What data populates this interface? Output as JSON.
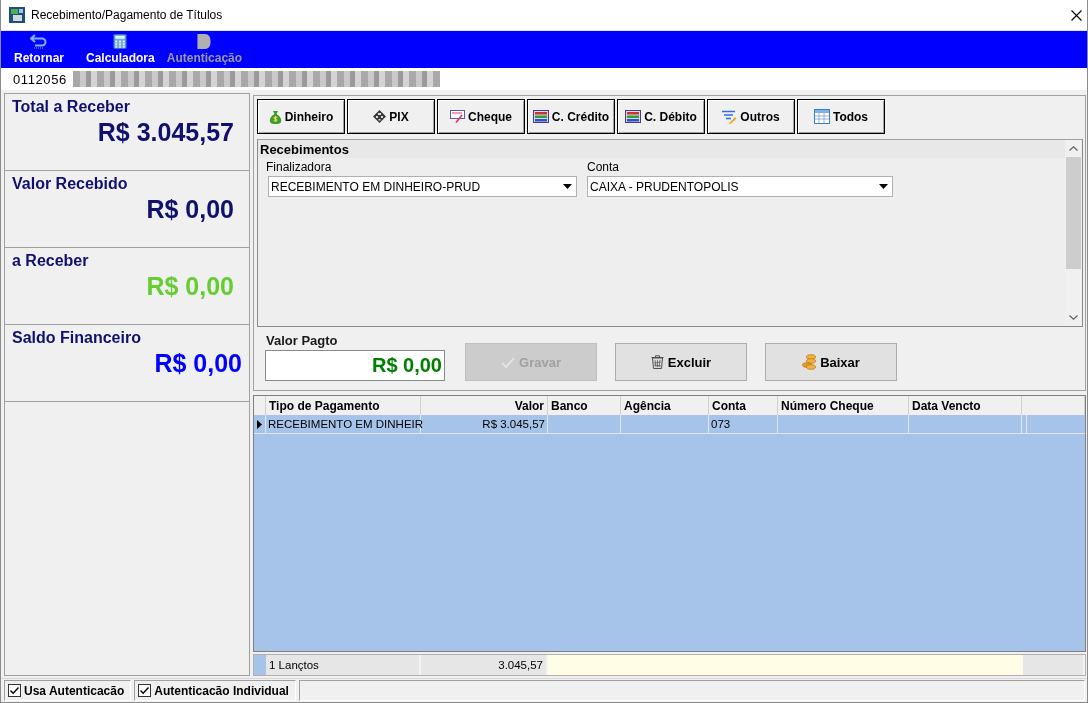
{
  "window": {
    "title": "Recebimento/Pagamento de Títulos"
  },
  "toolbar": [
    {
      "label": "Retornar",
      "disabled": false
    },
    {
      "label": "Calculadora",
      "disabled": false
    },
    {
      "label": "Autenticação",
      "disabled": true
    }
  ],
  "record": {
    "code": "0112056"
  },
  "summary": [
    {
      "label": "Total a Receber",
      "value": "R$ 3.045,57",
      "color": "#10106e"
    },
    {
      "label": "Valor Recebido",
      "value": "R$ 0,00",
      "color": "#10106e"
    },
    {
      "label": "a Receber",
      "value": "R$ 0,00",
      "color": "#66cc33"
    },
    {
      "label": "Saldo Financeiro",
      "value": "R$ 0,00",
      "color": "#0000ff"
    }
  ],
  "payment_buttons": [
    "Dinheiro",
    "PIX",
    "Cheque",
    "C. Crédito",
    "C. Débito",
    "Outros",
    "Todos"
  ],
  "recebimentos": {
    "title": "Recebimentos",
    "fields": [
      {
        "label": "Finalizadora",
        "value": "RECEBIMENTO EM DINHEIRO-PRUD"
      },
      {
        "label": "Conta",
        "value": "CAIXA - PRUDENTOPOLIS"
      }
    ]
  },
  "valor_pagto": {
    "label": "Valor Pagto",
    "value": "R$ 0,00"
  },
  "actions": [
    {
      "label": "Gravar",
      "disabled": true
    },
    {
      "label": "Excluir",
      "disabled": false
    },
    {
      "label": "Baixar",
      "disabled": false
    }
  ],
  "table": {
    "columns": [
      "Tipo de Pagamento",
      "Valor",
      "Banco",
      "Agência",
      "Conta",
      "Número Cheque",
      "Data Vencto"
    ],
    "rows": [
      {
        "selected": true,
        "tipo_de_pagamento": "RECEBIMENTO EM DINHEIR",
        "valor": "R$ 3.045,57",
        "conta": "073"
      }
    ],
    "footer": {
      "count": "1 Lançtos",
      "total": "3.045,57"
    }
  },
  "status_bar": [
    {
      "label": "Usa Autenticacão",
      "checked": true
    },
    {
      "label": "Autenticacão Individual",
      "checked": true
    }
  ]
}
